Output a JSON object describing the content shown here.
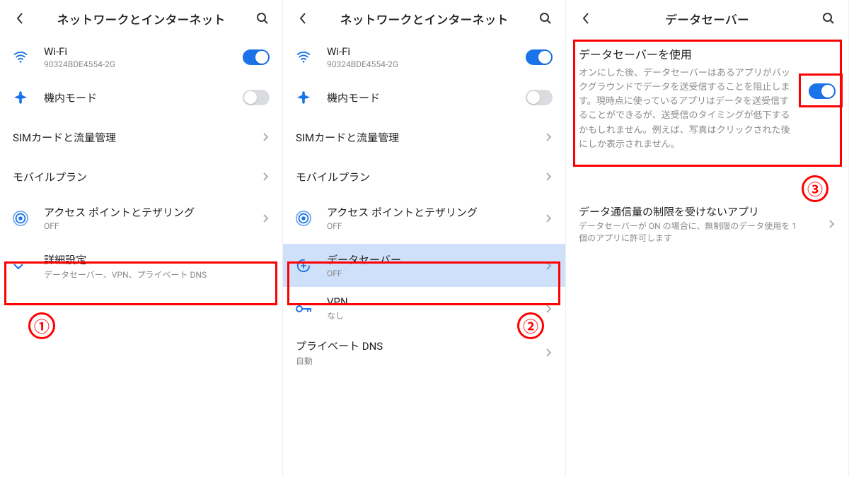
{
  "colors": {
    "accent": "#1a73e8",
    "highlight": "#ff0000",
    "selected_bg": "#cfe0fb"
  },
  "panel1": {
    "header": {
      "title": "ネットワークとインターネット"
    },
    "wifi": {
      "label": "Wi-Fi",
      "sub": "90324BDE4554-2G",
      "on": true
    },
    "airplane": {
      "label": "機内モード",
      "on": false
    },
    "sim": {
      "label": "SIMカードと流量管理"
    },
    "mobile_plan": {
      "label": "モバイルプラン"
    },
    "hotspot": {
      "label": "アクセス ポイントとテザリング",
      "sub": "OFF"
    },
    "advanced": {
      "label": "詳細設定",
      "sub": "データセーバー、VPN、プライベート DNS"
    },
    "step_label": "①"
  },
  "panel2": {
    "header": {
      "title": "ネットワークとインターネット"
    },
    "wifi": {
      "label": "Wi-Fi",
      "sub": "90324BDE4554-2G",
      "on": true
    },
    "airplane": {
      "label": "機内モード",
      "on": false
    },
    "sim": {
      "label": "SIMカードと流量管理"
    },
    "mobile_plan": {
      "label": "モバイルプラン"
    },
    "hotspot": {
      "label": "アクセス ポイントとテザリング",
      "sub": "OFF"
    },
    "data_saver": {
      "label": "データセーバー",
      "sub": "OFF"
    },
    "vpn": {
      "label": "VPN",
      "sub": "なし"
    },
    "private_dns": {
      "label": "プライベート DNS",
      "sub": "自動"
    },
    "step_label": "②"
  },
  "panel3": {
    "header": {
      "title": "データセーバー"
    },
    "use": {
      "title": "データセーバーを使用",
      "desc": "オンにした後、データセーバーはあるアプリがバックグラウンドでデータを送受信することを阻止します。現時点に使っているアプリはデータを送受信することができるが、送受信のタイミングが低下するかもしれません。例えば、写真はクリックされた後にしか表示されません。",
      "on": true
    },
    "unrestricted": {
      "label": "データ通信量の制限を受けないアプリ",
      "sub": "データセーバーが ON の場合に、無制限のデータ使用を 1 個のアプリに許可します"
    },
    "step_label": "③"
  }
}
